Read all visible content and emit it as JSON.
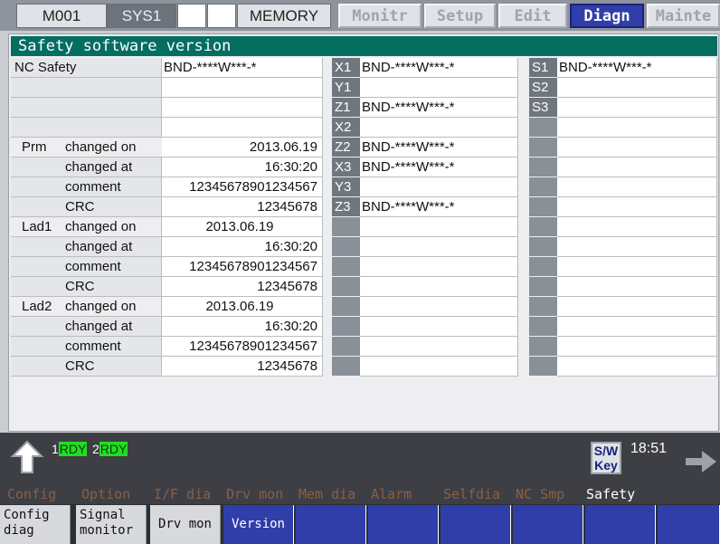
{
  "status_bar": {
    "mode": "M001",
    "system": "SYS1",
    "memory": "MEMORY",
    "tabs": [
      "Monitr",
      "Setup",
      "Edit",
      "Diagn",
      "Mainte"
    ]
  },
  "title": "Safety software version",
  "nc_safety": {
    "label": "NC Safety",
    "value": "BND-****W***-*"
  },
  "rows": [
    {
      "group": "Prm",
      "item": "changed on",
      "value": "2013.06.19"
    },
    {
      "group": "",
      "item": "changed at",
      "value": "16:30:20"
    },
    {
      "group": "",
      "item": "comment",
      "value": "12345678901234567"
    },
    {
      "group": "",
      "item": "CRC",
      "value": "12345678"
    },
    {
      "group": "Lad1",
      "item": "changed on",
      "value": "2013.06.19"
    },
    {
      "group": "",
      "item": "changed at",
      "value": "16:30:20"
    },
    {
      "group": "",
      "item": "comment",
      "value": "12345678901234567"
    },
    {
      "group": "",
      "item": "CRC",
      "value": "12345678"
    },
    {
      "group": "Lad2",
      "item": "changed on",
      "value": "2013.06.19"
    },
    {
      "group": "",
      "item": "changed at",
      "value": "16:30:20"
    },
    {
      "group": "",
      "item": "comment",
      "value": "12345678901234567"
    },
    {
      "group": "",
      "item": "CRC",
      "value": "12345678"
    }
  ],
  "axes": [
    {
      "name": "X1",
      "version": "BND-****W***-*"
    },
    {
      "name": "Y1",
      "version": ""
    },
    {
      "name": "Z1",
      "version": "BND-****W***-*"
    },
    {
      "name": "X2",
      "version": ""
    },
    {
      "name": "Z2",
      "version": "BND-****W***-*"
    },
    {
      "name": "X3",
      "version": "BND-****W***-*"
    },
    {
      "name": "Y3",
      "version": ""
    },
    {
      "name": "Z3",
      "version": "BND-****W***-*"
    }
  ],
  "spindles": [
    {
      "name": "S1",
      "version": "BND-****W***-*"
    },
    {
      "name": "S2",
      "version": ""
    },
    {
      "name": "S3",
      "version": ""
    }
  ],
  "bottom": {
    "rdy1_num": "1",
    "rdy1": "RDY",
    "rdy2_num": "2",
    "rdy2": "RDY",
    "sw_key_line1": "S/W",
    "sw_key_line2": "Key",
    "clock": "18:51"
  },
  "menu": [
    "Config",
    "Option",
    "I/F dia",
    "Drv mon",
    "Mem dia",
    "Alarm",
    "Selfdia",
    "NC Smp",
    "Safety"
  ],
  "fkeys": {
    "config_diag_1": "Config",
    "config_diag_2": "diag",
    "signal_monitor_1": "Signal",
    "signal_monitor_2": "monitor",
    "drv_mon": "Drv mon",
    "version": "Version"
  },
  "colors": {
    "title_bg": "#046e60",
    "active_tab": "#2f3ea8",
    "rdy": "#22dd22"
  }
}
